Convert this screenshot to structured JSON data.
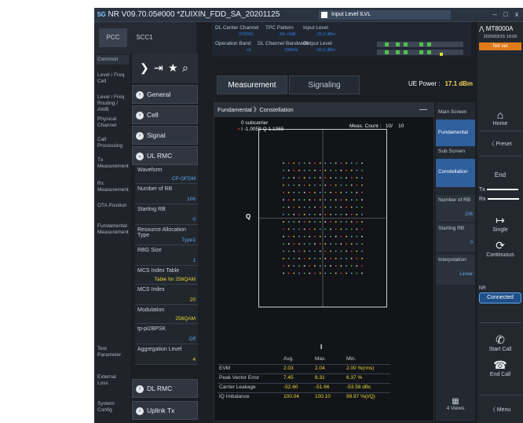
{
  "titlebar": {
    "title": "NR V09.70.05#000 *ZUIXIN_FDD_SA_20201125",
    "badge": "5G",
    "input_level": "Input Level",
    "input_level_mode": "ILVL",
    "controls": [
      "–",
      "□",
      "x"
    ]
  },
  "left_tabs": [
    "PCC",
    "SCC1"
  ],
  "nav": [
    "Common",
    "Level / Freq Cell",
    "Level / Freq Routing / AWB",
    "Physical Channel",
    "Call Processing",
    "Tx Measurement",
    "Rx Measurement",
    "OTA Position",
    "Fundamental Measurement",
    "Test Parameter",
    "External Loss",
    "System Config"
  ],
  "sections": {
    "general": "General",
    "cell": "Cell",
    "signal": "Signal",
    "ul_rmc": "UL RMC",
    "dl_rmc": "DL RMC",
    "uplink": "Uplink Tx Switching"
  },
  "params": [
    {
      "label": "Waveform",
      "value": "CP-OFDM",
      "vstyle": "v"
    },
    {
      "label": "Number of RB",
      "value": "106",
      "vstyle": "v"
    },
    {
      "label": "Starting RB",
      "value": "0",
      "vstyle": "v"
    },
    {
      "label": "Resource Allocation Type",
      "value": "Type1",
      "vstyle": "v"
    },
    {
      "label": "RBG Size",
      "value": "1",
      "vstyle": "v"
    },
    {
      "label": "MCS Index Table",
      "value": "Table for 256QAM",
      "vstyle": "vy"
    },
    {
      "label": "MCS Index",
      "value": "20",
      "vstyle": "vy"
    },
    {
      "label": "Modulation",
      "value": "256QAM",
      "vstyle": "vy"
    },
    {
      "label": "tp-pi2BPSK",
      "value": "Off",
      "vstyle": "v"
    },
    {
      "label": "Aggregation Level",
      "value": "4",
      "vstyle": "vy"
    }
  ],
  "top_info": {
    "dl_center": "DL Center Channel",
    "dl_center_v": "370000",
    "tpc": "TPC Pattern",
    "tpc_v": "All +3dB",
    "input_level": "Input Level",
    "input_level_v": "-25.0 dBm",
    "op_band": "Operation Band",
    "op_band_v": "n1",
    "dl_bw": "DL Channel Bandwidth",
    "dl_bw_v": "20MHz",
    "output": "Output Level",
    "output_v": "-50.0 dBm"
  },
  "tabs": [
    "Measurement",
    "Signaling"
  ],
  "ue_power": {
    "label": "UE Power :",
    "value": "17.1 dBm"
  },
  "panel": {
    "breadcrumb": "Fundamental 》Constellation",
    "subcarrier": "0 subcarrier",
    "iq": "I -1.0059 Q 1.1365",
    "meas_count_label": "Meas. Count :",
    "meas_count": "10/",
    "meas_total": "10",
    "q_label": "Q",
    "i_label": "I"
  },
  "stats": {
    "headers": [
      "Avg.",
      "Max.",
      "Min."
    ],
    "rows": [
      {
        "label": "EVM",
        "avg": "2.03",
        "max": "2.04",
        "min": "2.00 %(rms)"
      },
      {
        "label": "Peak Vector Error",
        "avg": "7.45",
        "max": "8.31",
        "min": "6.37 %"
      },
      {
        "label": "Carrier Leakage",
        "avg": "-52.60",
        "max": "-51.66",
        "min": "-53.58 dBc"
      },
      {
        "label": "IQ Imbalance",
        "avg": "100.04",
        "max": "100.10",
        "min": "99.97 %(I/Q)"
      }
    ]
  },
  "right_col": {
    "main_screen": "Main Screen",
    "fundamental": "Fundamental",
    "sub_screen": "Sub Screen",
    "constellation": "Constellation",
    "num_rb": "Number of RB",
    "num_rb_v": "106",
    "start_rb": "Starting RB",
    "start_rb_v": "0",
    "interp": "Interpolation",
    "interp_v": "Linear",
    "views": "4 Views"
  },
  "far": {
    "device": "MT8000A",
    "date": "2020/03/15 10:00",
    "net": "Not set",
    "home": "Home",
    "preset": "Preset",
    "end": "End",
    "tx": "Tx",
    "rx": "Rx",
    "single": "Single",
    "continuous": "Continuous",
    "nr": "NR",
    "connected": "Connected",
    "start_call": "Start Call",
    "end_call": "End Call",
    "menu": "Menu"
  },
  "chart_data": {
    "type": "scatter",
    "title": "Constellation",
    "xlabel": "I",
    "ylabel": "Q",
    "modulation": "256QAM",
    "grid": "16x16 points"
  }
}
